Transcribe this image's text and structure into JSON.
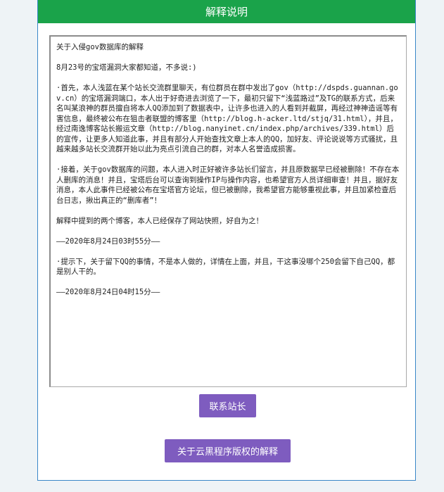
{
  "header": {
    "title": "解释说明"
  },
  "content": {
    "paragraphs": [
      "关于入侵gov数据库的解释",
      "8月23号的宝塔漏洞大家都知道，不多说:)",
      "·首先，本人浅蓝在某个站长交流群里聊天，有位群员在群中发出了gov（http://dspds.guannan.gov.cn）的宝塔漏洞端口，本人出于好奇进去浏览了一下，最初只留下“浅蓝路过”及TG的联系方式，后来名叫某浪神的群员擅自将本人QQ添加到了数据表中，让许多也进入的人看到并截屏，再经过神神造谣等有害信息，最终被公布在狙击者联盟的博客里（http://blog.h-acker.ltd/stjq/31.html），并且，经过南逸博客站长搬运文章（http://blog.nanyinet.cn/index.php/archives/339.html）后的宣传，让更多人知道此事，并且有部分人开始查找文章上本人的QQ，加好友、评论说说等方式骚扰，且越来越多站长交流群开始以此为亮点引流自己的群，对本人名誉造成损害。",
      "·接着，关于gov数据库的问题，本人进入时正好被许多站长们留言，并且原数据早已经被删除！不存在本人删库的消息！并且，宝塔后台可以查询到操作IP与操作内容，也希望官方人员详细审查！并且，据好友消息，本人此事件已经被公布在宝塔官方论坛，但已被删除，我希望官方能够重视此事，并且加紧检查后台日志，揪出真正的“删库者”！",
      "解释中提到的两个博客，本人已经保存了网站快照，好自为之！",
      "——2020年8月24日03时55分——",
      "·提示下，关于留下QQ的事情，不是本人做的，详情在上面，并且，干这事没哪个250会留下自己QQ，都是别人干的。",
      "——2020年8月24日04时15分——"
    ]
  },
  "buttons": {
    "contact_label": "联系站长",
    "copyright_label": "关于云黑程序版权的解释"
  },
  "colors": {
    "header_bg": "#1aa34a",
    "button_bg": "#7e5cbf",
    "panel_border": "#3a87c8"
  }
}
